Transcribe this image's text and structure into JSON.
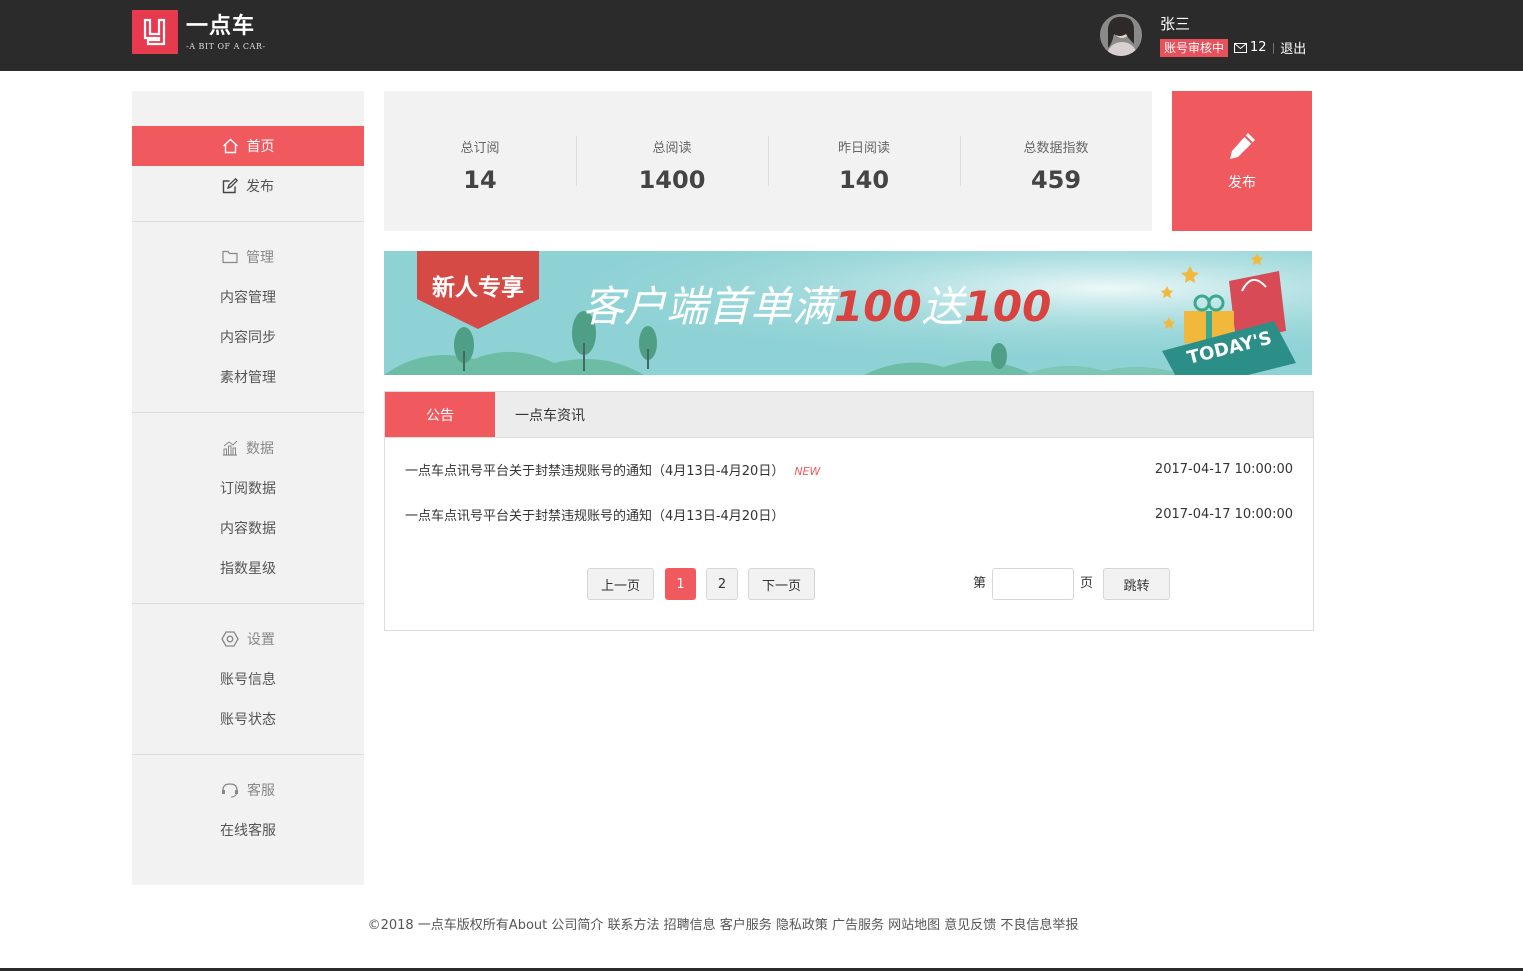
{
  "header": {
    "logo_cn": "一点车",
    "logo_en": "-A BIT OF A CAR-",
    "user_name": "张三",
    "account_status": "账号审核中",
    "message_count": "12",
    "logout": "退出"
  },
  "sidebar": {
    "home": "首页",
    "publish": "发布",
    "manage": "管理",
    "content_manage": "内容管理",
    "content_sync": "内容同步",
    "material_manage": "素材管理",
    "data": "数据",
    "subscribe_data": "订阅数据",
    "content_data": "内容数据",
    "index_level": "指数星级",
    "settings": "设置",
    "account_info": "账号信息",
    "account_status": "账号状态",
    "service": "客服",
    "online_service": "在线客服"
  },
  "stats": [
    {
      "label": "总订阅",
      "value": "14"
    },
    {
      "label": "总阅读",
      "value": "1400"
    },
    {
      "label": "昨日阅读",
      "value": "140"
    },
    {
      "label": "总数据指数",
      "value": "459"
    }
  ],
  "publish_tile": {
    "label": "发布"
  },
  "banner": {
    "tag": "新人专享",
    "slogan_text": "客户端首单满",
    "slogan_a": "100",
    "slogan_mid": "送",
    "slogan_b": "100",
    "ribbon": "TODAY'S"
  },
  "notice": {
    "tabs": [
      "公告",
      "一点车资讯"
    ],
    "items": [
      {
        "title": "一点车点讯号平台关于封禁违规账号的通知（4月13日-4月20日）",
        "tag": "NEW",
        "date": "2017-04-17 10:00:00"
      },
      {
        "title": "一点车点讯号平台关于封禁违规账号的通知（4月13日-4月20日）",
        "tag": "",
        "date": "2017-04-17 10:00:00"
      }
    ],
    "pager": {
      "prev": "上一页",
      "pages": [
        "1",
        "2"
      ],
      "next": "下一页",
      "goto_prefix": "第",
      "goto_suffix": "页",
      "goto_button": "跳转"
    }
  },
  "footer": {
    "text": "©2018 一点车版权所有About 公司简介 联系方法 招聘信息 客户服务 隐私政策 广告服务 网站地图 意见反馈 不良信息举报"
  },
  "colors": {
    "accent": "#f05a5f",
    "header_bg": "#2b2b2b",
    "panel_bg": "#f2f2f2",
    "banner_bg": "#8ed3d6"
  }
}
